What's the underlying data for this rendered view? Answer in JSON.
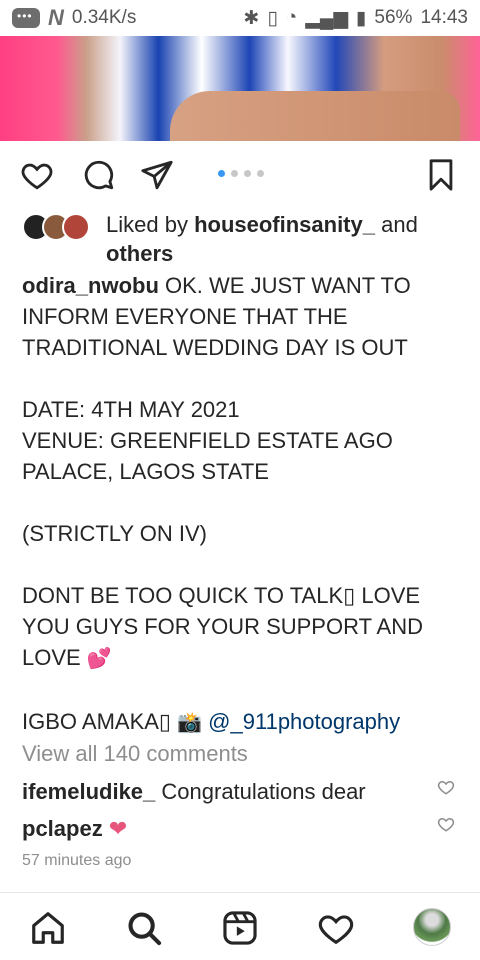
{
  "status_bar": {
    "speed": "0.34K/s",
    "battery": "56%",
    "time": "14:43"
  },
  "likes": {
    "prefix": "Liked by ",
    "user": "houseofinsanity_",
    "and": " and",
    "others": "others"
  },
  "caption": {
    "username": "odira_nwobu",
    "line1": " OK. WE JUST WANT TO INFORM EVERYONE THAT THE TRADITIONAL WEDDING DAY IS OUT",
    "date": "DATE: 4TH MAY 2021",
    "venue": "VENUE: GREENFIELD ESTATE AGO PALACE, LAGOS STATE",
    "strict": "(STRICTLY ON IV)",
    "thanks": "DONT BE TOO QUICK TO TALK▯ LOVE YOU GUYS FOR YOUR SUPPORT AND LOVE ",
    "thanks_emoji": "💕",
    "igbo": "IGBO AMAKA▯ ",
    "camera_emoji": "📸",
    "mention": " @_911photography"
  },
  "view_all_comments": "View all 140 comments",
  "comments": [
    {
      "username": "ifemeludike_",
      "text": " Congratulations dear"
    },
    {
      "username": "pclapez",
      "text": " ❤"
    }
  ],
  "time_ago": "57 minutes ago",
  "colors": {
    "accent_dot": "#3897f0",
    "mention": "#00376b",
    "heart_emoji": "#e8557c"
  }
}
